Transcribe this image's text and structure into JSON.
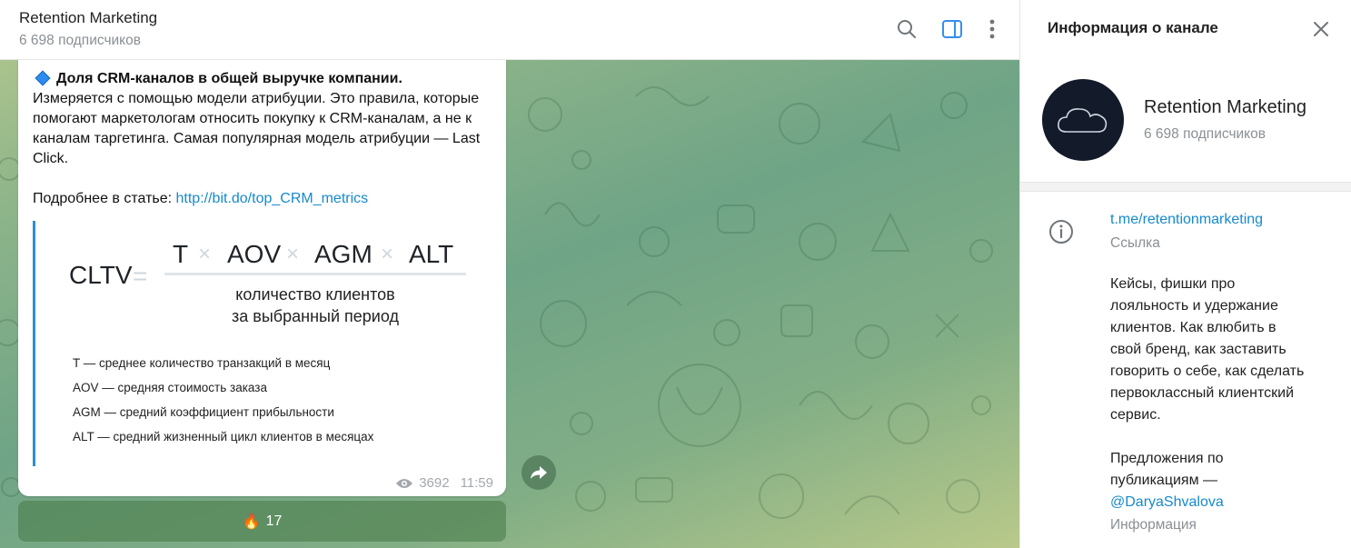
{
  "chat": {
    "title": "Retention Marketing",
    "subscribers": "6 698 подписчиков",
    "header_icons": [
      "search-icon",
      "sidebar-toggle-icon",
      "more-vertical-icon"
    ]
  },
  "message": {
    "heading": "Доля CRM-каналов в общей выручке компании.",
    "body": "Измеряется с помощью модели атрибуции. Это правила, которые помогают маркетологам относить покупку к CRM-каналам, а не к каналам таргетинга. Самая популярная модель атрибуции — Last Click.",
    "more_prefix": "Подробнее в статье: ",
    "more_link": "http://bit.do/top_CRM_metrics",
    "formula": {
      "lhs": "CLTV",
      "equals": "=",
      "terms": [
        "T",
        "AOV",
        "AGM",
        "ALT"
      ],
      "operator": "×",
      "denominator_line1": "количество клиентов",
      "denominator_line2": "за выбранный период",
      "legend": [
        "T — среднее количество транзакций в месяц",
        "AOV — средняя стоимость заказа",
        "AGM — средний коэффициент прибыльности",
        "ALT — средний жизненный цикл клиентов в месяцах"
      ]
    },
    "views": "3692",
    "time": "11:59",
    "reaction_emoji": "🔥",
    "reaction_count": "17"
  },
  "panel": {
    "title": "Информация о канале",
    "channel_name": "Retention Marketing",
    "subscribers": "6 698 подписчиков",
    "link": "t.me/retentionmarketing",
    "link_caption": "Ссылка",
    "description": "Кейсы, фишки про\nлояльность и удержание\nклиентов. Как влюбить в\nсвой бренд, как заставить\nговорить о себе, как сделать\nпервоклассный клиентский\nсервис.\n\nПредложения по\nпубликациям —",
    "mention": "@DaryaShvalova",
    "info_caption": "Информация"
  },
  "colors": {
    "accent": "#168acd",
    "avatar_bg": "#131a2a",
    "formula_bar": "#2f8fd0"
  }
}
